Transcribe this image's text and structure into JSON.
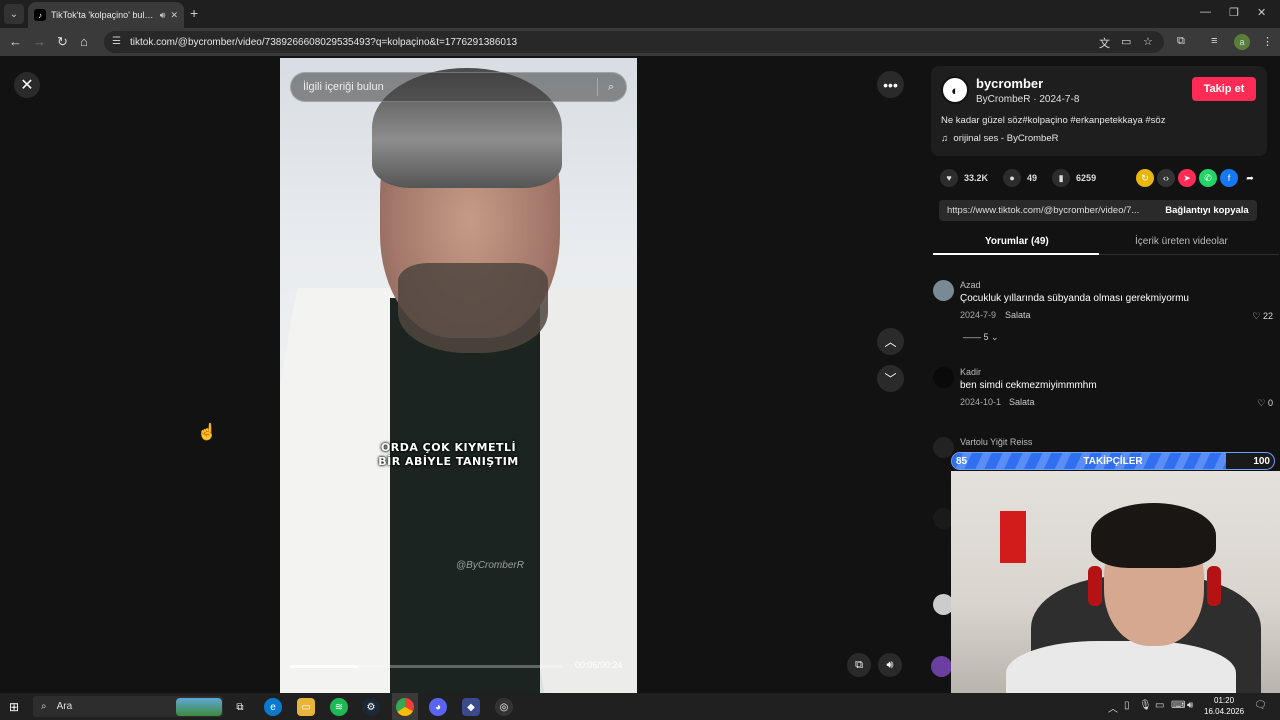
{
  "browser": {
    "tab_title": "TikTok'ta 'kolpaçino' bulab...",
    "tab_favicon": "tiktok-icon",
    "url": "tiktok.com/@bycromber/video/7389266608029535493?q=kolpaçino&t=1776291386013"
  },
  "video": {
    "search_placeholder": "İlgili içeriği bulun",
    "caption_line1": "ORDA ÇOK KIYMETLİ",
    "caption_line2": "BİR ABİYLE TANIŞTIM",
    "watermark": "@ByCromberR",
    "time": "00:06/00:24",
    "progress": 0.25
  },
  "author": {
    "username": "bycromber",
    "display": "ByCrombeR",
    "date": "2024-7-8",
    "follow_label": "Takip et",
    "description": "Ne kadar güzel söz#kolpaçino #erkanpetekkaya #söz",
    "music": "orijinal ses - ByCrombeR"
  },
  "stats": {
    "likes": "33.2K",
    "comments": "49",
    "saves": "6259"
  },
  "share": {
    "link": "https://www.tiktok.com/@bycromber/video/7...",
    "copy_label": "Bağlantıyı kopyala"
  },
  "tabs": {
    "comments": "Yorumlar (49)",
    "creator_videos": "İçerik üreten videolar"
  },
  "comments": [
    {
      "name": "Azad",
      "text": "Çocukluk yıllarında sübyanda olması gerekmiyormu",
      "date": "2024-7-9",
      "reply": "Salata",
      "likes": "22",
      "more": "5"
    },
    {
      "name": "Kadir",
      "text": "ben simdi cekmezmiyimmmhm",
      "date": "2024-10-1",
      "reply": "Salata",
      "likes": "0"
    },
    {
      "name": "Vartolu Yiğit Reiss"
    }
  ],
  "overlay": {
    "follower_label": "TAKİPÇİLER",
    "follower_min": "85",
    "follower_max": "100",
    "follower_progress": 0.85
  },
  "taskbar": {
    "search_label": "Ara",
    "time": "01:20",
    "date": "16.04.2026"
  },
  "colors": {
    "follow_button": "#fe2c55",
    "follower_bar": "#2f6ff0"
  }
}
